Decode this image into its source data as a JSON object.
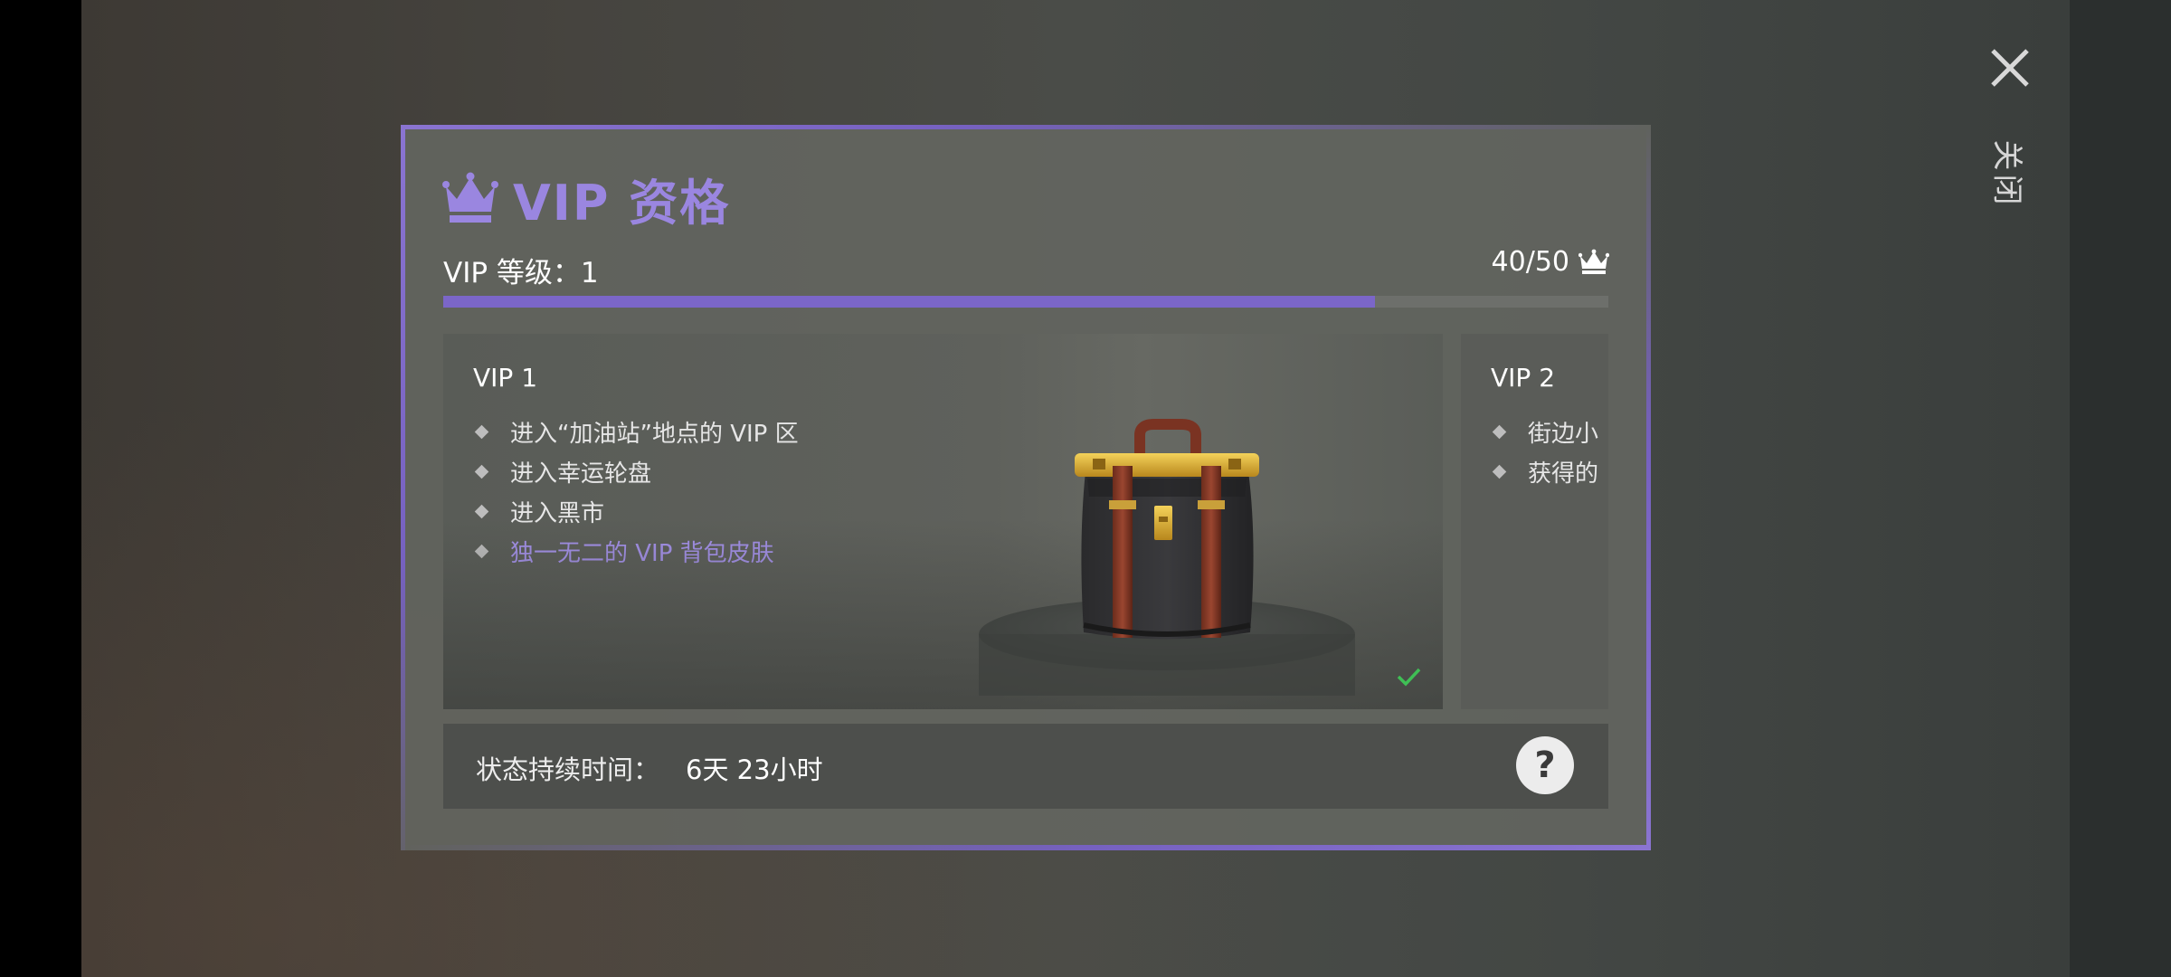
{
  "close": {
    "label": "关闭",
    "icon": "close-icon"
  },
  "modal": {
    "title": "VIP 资格",
    "title_icon": "crown-icon",
    "accent_color": "#8a74d1",
    "level_label": "VIP 等级：1",
    "progress_text": "40/50",
    "progress": {
      "current": 40,
      "max": 50
    },
    "tiers": [
      {
        "name": "VIP 1",
        "perks": [
          {
            "text": "进入“加油站”地点的 VIP 区",
            "highlight": false
          },
          {
            "text": "进入幸运轮盘",
            "highlight": false
          },
          {
            "text": "进入黑市",
            "highlight": false
          },
          {
            "text": "独一无二的 VIP 背包皮肤",
            "highlight": true
          }
        ],
        "reward_icon": "backpack-icon",
        "status_icon": "check-icon"
      },
      {
        "name": "VIP 2",
        "perks": [
          {
            "text": "街边小",
            "highlight": false
          },
          {
            "text": "获得的",
            "highlight": false
          }
        ]
      }
    ],
    "status": {
      "label": "状态持续时间：",
      "value": "6天 23小时",
      "help_icon": "help-icon",
      "help_symbol": "?"
    }
  }
}
